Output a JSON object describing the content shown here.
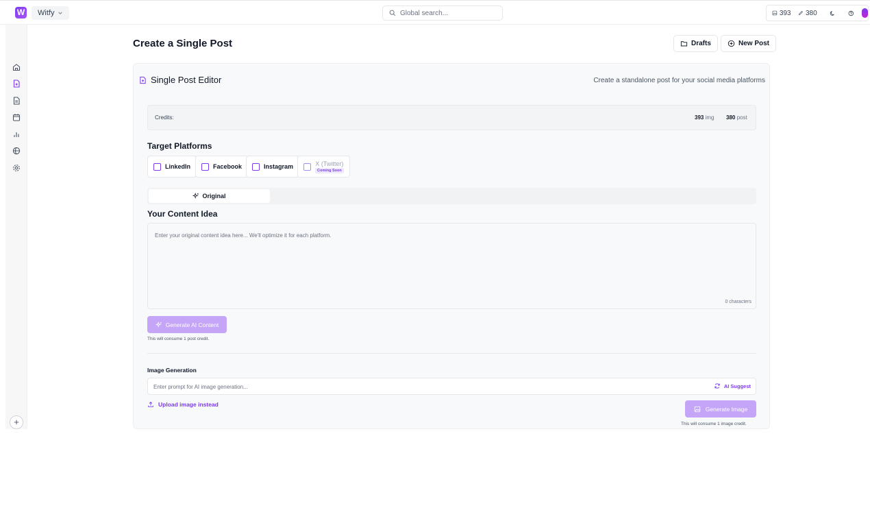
{
  "topbar": {
    "logo_letter": "W",
    "workspace": "Witfy",
    "search_placeholder": "Global search...",
    "image_credits": "393",
    "post_credits": "380"
  },
  "sidebar": {
    "items": [
      "home-icon",
      "new-post-icon",
      "document-icon",
      "calendar-icon",
      "analytics-icon",
      "globe-icon",
      "settings-icon"
    ],
    "add_label": "+"
  },
  "header": {
    "title": "Create a Single Post",
    "drafts_label": "Drafts",
    "new_post_label": "New Post"
  },
  "editor": {
    "title": "Single Post Editor",
    "subtitle": "Create a standalone post for your social media platforms",
    "credits": {
      "label": "Credits:",
      "img_value": "393",
      "img_unit": "img",
      "post_value": "380",
      "post_unit": "post"
    },
    "platforms_heading": "Target Platforms",
    "platforms": [
      {
        "label": "LinkedIn"
      },
      {
        "label": "Facebook"
      },
      {
        "label": "Instagram"
      },
      {
        "label": "X (Twitter)",
        "badge": "Coming Soon"
      }
    ],
    "tab_label": "Original",
    "content_heading": "Your Content Idea",
    "content_placeholder": "Enter your original content idea here... We'll optimize it for each platform.",
    "char_count": "0 characters",
    "generate_label": "Generate AI Content",
    "generate_hint": "This will consume 1 post credit.",
    "image_heading": "Image Generation",
    "image_placeholder": "Enter prompt for AI image generation...",
    "ai_suggest_label": "AI Suggest",
    "upload_label": "Upload image instead",
    "generate_image_label": "Generate Image",
    "generate_image_hint": "This will consume 1 image credit."
  },
  "colors": {
    "accent": "#7c3aed",
    "button_disabled": "#c4a5f7"
  }
}
